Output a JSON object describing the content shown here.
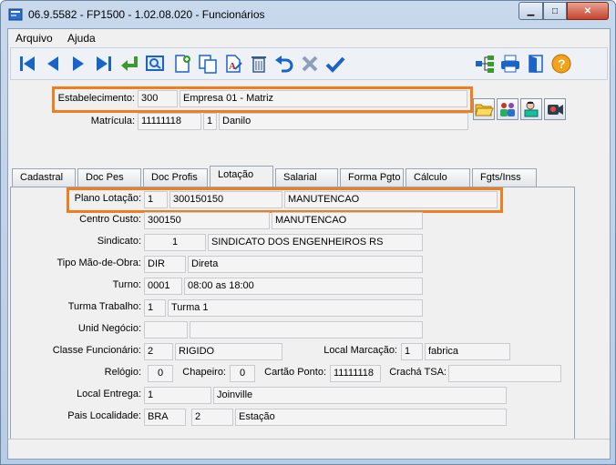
{
  "window": {
    "title": "06.9.5582 - FP1500 - 1.02.08.020 - Funcionários",
    "min_glyph": "▁",
    "max_glyph": "□",
    "close_glyph": "✕"
  },
  "menu": {
    "items": [
      "Arquivo",
      "Ajuda"
    ]
  },
  "toolbar": {
    "buttons": [
      "first-icon",
      "previous-icon",
      "next-icon",
      "last-icon",
      "return-icon",
      "search-icon",
      "new-icon",
      "copy-icon",
      "edit-icon",
      "delete-icon",
      "undo-icon",
      "cancel-icon",
      "confirm-icon",
      "tree-icon",
      "print-icon",
      "exit-icon",
      "help-icon"
    ]
  },
  "header": {
    "estabelecimento_label": "Estabelecimento:",
    "estabelecimento_code": "300",
    "estabelecimento_name": "Empresa 01 - Matriz",
    "matricula_label": "Matrícula:",
    "matricula_code": "11111118",
    "matricula_seq": "1",
    "matricula_name": "Danilo"
  },
  "tabs": [
    "Cadastral",
    "Doc Pes",
    "Doc Profis",
    "Lotação",
    "Salarial",
    "Forma Pgto",
    "Cálculo",
    "Fgts/Inss"
  ],
  "active_tab": "Lotação",
  "lotacao": {
    "plano_lotacao_label": "Plano Lotação:",
    "plano_lotacao_num": "1",
    "plano_lotacao_code": "300150150",
    "plano_lotacao_desc": "MANUTENCAO",
    "centro_custo_label": "Centro Custo:",
    "centro_custo_code": "300150",
    "centro_custo_desc": "MANUTENCAO",
    "sindicato_label": "Sindicato:",
    "sindicato_code": "1",
    "sindicato_desc": "SINDICATO DOS ENGENHEIROS RS",
    "tipo_mao_obra_label": "Tipo Mão-de-Obra:",
    "tipo_mao_obra_code": "DIR",
    "tipo_mao_obra_desc": "Direta",
    "turno_label": "Turno:",
    "turno_code": "0001",
    "turno_desc": "08:00 as 18:00",
    "turma_trabalho_label": "Turma Trabalho:",
    "turma_trabalho_code": "1",
    "turma_trabalho_desc": "Turma 1",
    "unid_negocio_label": "Unid Negócio:",
    "unid_negocio_code": "",
    "unid_negocio_desc": "",
    "classe_func_label": "Classe Funcionário:",
    "classe_func_code": "2",
    "classe_func_desc": "RIGIDO",
    "local_marcacao_label": "Local Marcação:",
    "local_marcacao_code": "1",
    "local_marcacao_desc": "fabrica",
    "relogio_label": "Relógio:",
    "relogio_value": "0",
    "chapeiro_label": "Chapeiro:",
    "chapeiro_value": "0",
    "cartao_ponto_label": "Cartão Ponto:",
    "cartao_ponto_value": "11111118",
    "cracha_tsa_label": "Crachá TSA:",
    "cracha_tsa_value": "",
    "local_entrega_label": "Local Entrega:",
    "local_entrega_code": "1",
    "local_entrega_desc": "Joinville",
    "pais_localidade_label": "Pais Localidade:",
    "pais_localidade_code": "BRA",
    "pais_localidade_num": "2",
    "pais_localidade_desc": "Estação"
  },
  "colors": {
    "highlight": "#f07d1e",
    "toolbar_blue": "#1a64c8",
    "title_bg": "#c9d9ec"
  }
}
